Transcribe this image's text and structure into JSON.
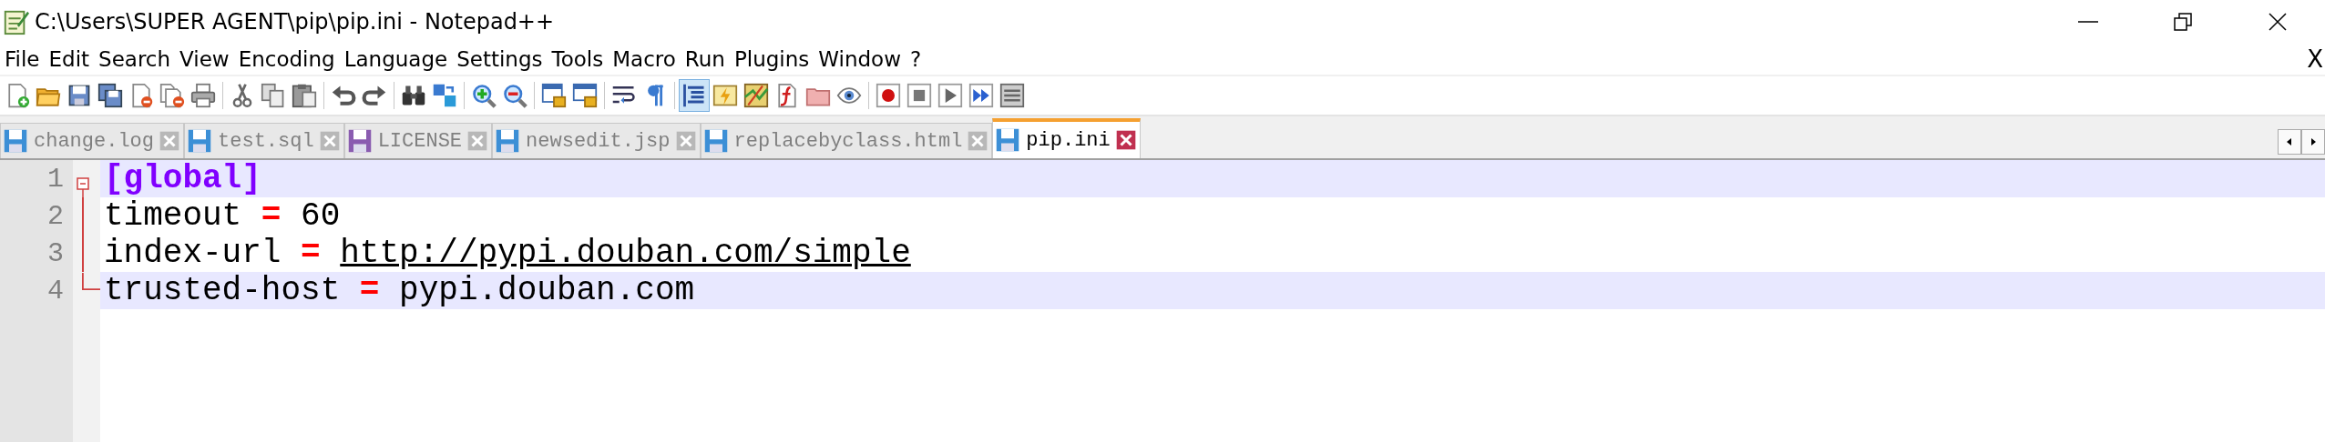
{
  "window": {
    "title": "C:\\Users\\SUPER AGENT\\pip\\pip.ini - Notepad++"
  },
  "menu": {
    "items": [
      "File",
      "Edit",
      "Search",
      "View",
      "Encoding",
      "Language",
      "Settings",
      "Tools",
      "Macro",
      "Run",
      "Plugins",
      "Window",
      "?"
    ],
    "close_label": "X"
  },
  "toolbar": {
    "groups": [
      {
        "buttons": [
          {
            "selected": false
          },
          {
            "selected": false
          },
          {
            "selected": false
          },
          {
            "selected": false
          },
          {
            "selected": false
          },
          {
            "selected": false
          },
          {
            "selected": false
          }
        ]
      },
      {
        "buttons": [
          {
            "selected": false
          },
          {
            "selected": false
          },
          {
            "selected": false
          }
        ]
      },
      {
        "buttons": [
          {
            "selected": false
          },
          {
            "selected": false
          }
        ]
      },
      {
        "buttons": [
          {
            "selected": false
          },
          {
            "selected": false
          }
        ]
      },
      {
        "buttons": [
          {
            "selected": false
          },
          {
            "selected": false
          }
        ]
      },
      {
        "buttons": [
          {
            "selected": false
          },
          {
            "selected": false
          }
        ]
      },
      {
        "buttons": [
          {
            "selected": false
          },
          {
            "selected": false
          }
        ]
      },
      {
        "buttons": [
          {
            "selected": true
          },
          {
            "selected": false
          },
          {
            "selected": false
          },
          {
            "selected": false
          },
          {
            "selected": false
          },
          {
            "selected": false
          }
        ]
      },
      {
        "buttons": [
          {
            "selected": false
          },
          {
            "selected": false
          },
          {
            "selected": false
          },
          {
            "selected": false
          },
          {
            "selected": false
          }
        ]
      }
    ]
  },
  "tabs": [
    {
      "label": "change.log",
      "selected": false,
      "color": "#3c8fd6"
    },
    {
      "label": "test.sql",
      "selected": false,
      "color": "#3c8fd6"
    },
    {
      "label": "LICENSE",
      "selected": false,
      "color": "#8a5cb0"
    },
    {
      "label": "newsedit.jsp",
      "selected": false,
      "color": "#3c8fd6"
    },
    {
      "label": "replacebyclass.html",
      "selected": false,
      "color": "#3c8fd6"
    },
    {
      "label": "pip.ini",
      "selected": true,
      "color": "#3c8fd6"
    }
  ],
  "editor": {
    "lines": [
      {
        "number": "1",
        "highlighted": true,
        "fold_header": true,
        "fold_end": false,
        "tokens": [
          {
            "kind": "section",
            "text": "[global]"
          }
        ]
      },
      {
        "number": "2",
        "highlighted": false,
        "fold_header": false,
        "fold_end": false,
        "tokens": [
          {
            "kind": "key",
            "text": "timeout"
          },
          {
            "kind": "operator",
            "text": "="
          },
          {
            "kind": "value",
            "text": "60"
          }
        ]
      },
      {
        "number": "3",
        "highlighted": false,
        "fold_header": false,
        "fold_end": false,
        "tokens": [
          {
            "kind": "key",
            "text": "index-url"
          },
          {
            "kind": "operator",
            "text": "="
          },
          {
            "kind": "url",
            "text": "http://pypi.douban.com/simple"
          }
        ]
      },
      {
        "number": "4",
        "highlighted": true,
        "fold_header": false,
        "fold_end": true,
        "tokens": [
          {
            "kind": "key",
            "text": "trusted-host"
          },
          {
            "kind": "operator",
            "text": "="
          },
          {
            "kind": "value",
            "text": "pypi.douban.com"
          }
        ]
      }
    ]
  }
}
